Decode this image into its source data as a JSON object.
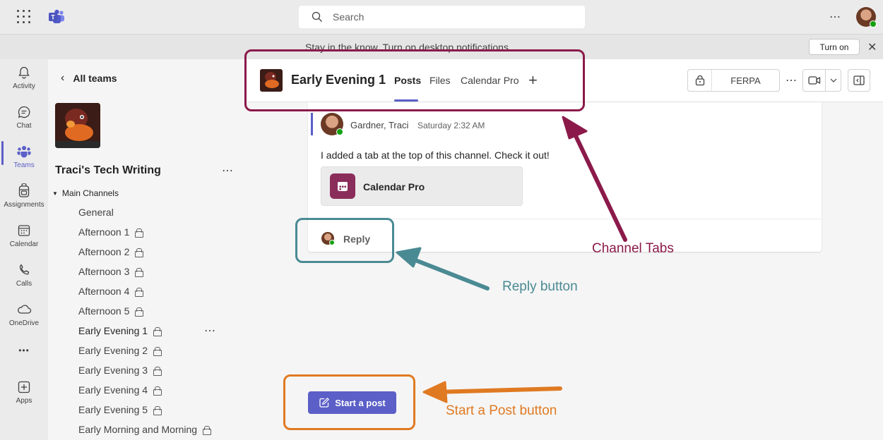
{
  "topbar": {
    "search_placeholder": "Search",
    "more_label": "⋯"
  },
  "notification": {
    "text": "Stay in the know. Turn on desktop notifications.",
    "turn_on_label": "Turn on",
    "close_label": "✕"
  },
  "rail": {
    "items": [
      {
        "label": "Activity",
        "icon": "bell-icon"
      },
      {
        "label": "Chat",
        "icon": "chat-icon"
      },
      {
        "label": "Teams",
        "icon": "teams-icon"
      },
      {
        "label": "Assignments",
        "icon": "backpack-icon"
      },
      {
        "label": "Calendar",
        "icon": "calendar-icon"
      },
      {
        "label": "Calls",
        "icon": "phone-icon"
      },
      {
        "label": "OneDrive",
        "icon": "cloud-icon"
      },
      {
        "label": "Apps",
        "icon": "add-app-icon"
      }
    ],
    "more_label": "•••",
    "active": "Teams"
  },
  "pane": {
    "back_label": "All teams",
    "team_name": "Traci's Tech Writing",
    "more_label": "⋯",
    "section_label": "Main Channels",
    "channels": [
      {
        "name": "General",
        "private": false
      },
      {
        "name": "Afternoon 1",
        "private": true
      },
      {
        "name": "Afternoon 2",
        "private": true
      },
      {
        "name": "Afternoon 3",
        "private": true
      },
      {
        "name": "Afternoon 4",
        "private": true
      },
      {
        "name": "Afternoon 5",
        "private": true
      },
      {
        "name": "Early Evening 1",
        "private": true
      },
      {
        "name": "Early Evening 2",
        "private": true
      },
      {
        "name": "Early Evening 3",
        "private": true
      },
      {
        "name": "Early Evening 4",
        "private": true
      },
      {
        "name": "Early Evening 5",
        "private": true
      },
      {
        "name": "Early Morning and Morning",
        "private": true
      }
    ],
    "active_channel": "Early Evening 1"
  },
  "header": {
    "channel_title": "Early Evening 1",
    "tabs": [
      "Posts",
      "Files",
      "Calendar Pro"
    ],
    "active_tab": "Posts",
    "add_tab_label": "+",
    "sensitivity_label": "FERPA",
    "more_label": "⋯"
  },
  "post": {
    "author": "Gardner, Traci",
    "time": "Saturday 2:32 AM",
    "body": "I added a tab at the top of this channel. Check it out!",
    "card_label": "Calendar Pro",
    "reply_label": "Reply"
  },
  "compose": {
    "start_post_label": "Start a post"
  },
  "annotations": {
    "channel_tabs": {
      "label": "Channel Tabs",
      "color": "#8b1a4a"
    },
    "reply_button": {
      "label": "Reply button",
      "color": "#4a8a93"
    },
    "start_post_button": {
      "label": "Start a Post button",
      "color": "#e07a22"
    }
  },
  "colors": {
    "brand": "#5b5fc7",
    "presence_available": "#13a10e"
  }
}
